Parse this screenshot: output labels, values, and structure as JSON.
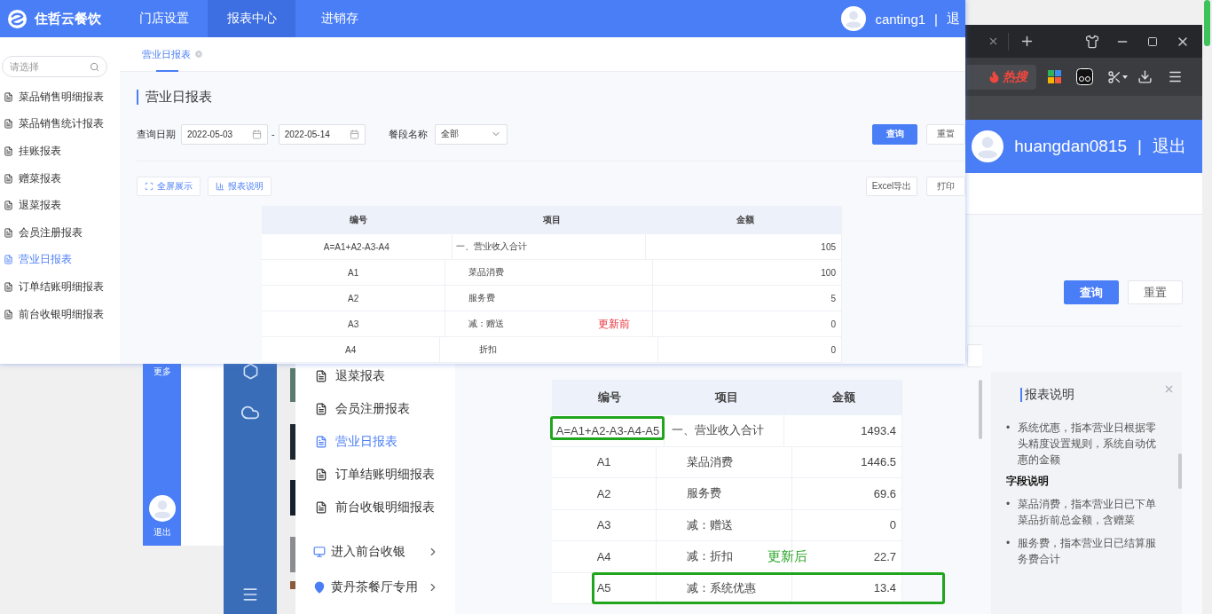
{
  "front_window": {
    "app_name": "住哲云餐饮",
    "nav": [
      {
        "label": "门店设置",
        "selected": false
      },
      {
        "label": "报表中心",
        "selected": true
      },
      {
        "label": "进销存",
        "selected": false
      }
    ],
    "user": {
      "name": "canting1",
      "separator": "|",
      "logout": "退"
    },
    "search": {
      "placeholder": "请选择"
    },
    "menu": [
      {
        "label": "菜品销售明细报表",
        "selected": false
      },
      {
        "label": "菜品销售统计报表",
        "selected": false
      },
      {
        "label": "挂账报表",
        "selected": false
      },
      {
        "label": "赠菜报表",
        "selected": false
      },
      {
        "label": "退菜报表",
        "selected": false
      },
      {
        "label": "会员注册报表",
        "selected": false
      },
      {
        "label": "营业日报表",
        "selected": true
      },
      {
        "label": "订单结账明细报表",
        "selected": false
      },
      {
        "label": "前台收银明细报表",
        "selected": false
      }
    ],
    "tabs": [
      {
        "label": "营业日报表",
        "selected": true
      }
    ],
    "page_title": "营业日报表",
    "filters": {
      "date_label": "查询日期",
      "date_from": "2022-05-03",
      "date_separator": "-",
      "date_to": "2022-05-14",
      "meal_label": "餐段名称",
      "meal_value": "全部"
    },
    "buttons": [
      {
        "label": "查询",
        "kind": "primary"
      },
      {
        "label": "重置",
        "kind": "default"
      }
    ],
    "tools": [
      {
        "label": "全屏展示",
        "kind": "fullscreen"
      },
      {
        "label": "报表说明",
        "kind": "chart"
      }
    ],
    "exports": [
      {
        "label": "Excel导出"
      },
      {
        "label": "打印"
      }
    ],
    "table": {
      "columns": [
        "编号",
        "项目",
        "金额"
      ],
      "rows": [
        {
          "code": "A=A1+A2-A3-A4",
          "item": "一、营业收入合计",
          "amount": "105",
          "kind": "total"
        },
        {
          "code": "A1",
          "item": "菜品消费",
          "amount": "100",
          "kind": "item"
        },
        {
          "code": "A2",
          "item": "服务费",
          "amount": "5",
          "kind": "item"
        },
        {
          "code": "A3",
          "item": "减：赠送",
          "amount": "0",
          "kind": "item",
          "note": "更新前"
        },
        {
          "code": "A4",
          "item": "折扣",
          "amount": "0",
          "kind": "detail"
        }
      ]
    }
  },
  "side_window": {
    "more": "更多",
    "logout": "退出"
  },
  "back_window": {
    "hot_search": "热搜",
    "user": {
      "name": "huangdan0815",
      "separator": "|",
      "logout": "退出"
    },
    "buttons": [
      {
        "label": "查询",
        "kind": "primary"
      },
      {
        "label": "重置",
        "kind": "default"
      }
    ],
    "menu": [
      {
        "label": "退菜报表",
        "selected": false
      },
      {
        "label": "会员注册报表",
        "selected": false
      },
      {
        "label": "营业日报表",
        "selected": true
      },
      {
        "label": "订单结账明细报表",
        "selected": false
      },
      {
        "label": "前台收银明细报表",
        "selected": false
      }
    ],
    "links": [
      {
        "label": "进入前台收银",
        "kind": "cashier"
      },
      {
        "label": "黄丹茶餐厅专用",
        "kind": "location"
      }
    ],
    "table": {
      "columns": [
        "编号",
        "项目",
        "金额"
      ],
      "rows": [
        {
          "code": "A=A1+A2-A3-A4-A5",
          "item": "一、营业收入合计",
          "amount": "1493.4",
          "kind": "total",
          "code_highlighted": true,
          "row_highlighted": false
        },
        {
          "code": "A1",
          "item": "菜品消费",
          "amount": "1446.5",
          "kind": "item",
          "code_highlighted": false,
          "row_highlighted": false
        },
        {
          "code": "A2",
          "item": "服务费",
          "amount": "69.6",
          "kind": "item",
          "code_highlighted": false,
          "row_highlighted": false
        },
        {
          "code": "A3",
          "item": "减：赠送",
          "amount": "0",
          "kind": "item",
          "code_highlighted": false,
          "row_highlighted": false
        },
        {
          "code": "A4",
          "item": "减：折扣",
          "amount": "22.7",
          "kind": "item",
          "code_highlighted": false,
          "row_highlighted": false,
          "note": "更新后"
        },
        {
          "code": "A5",
          "item": "减：系统优惠",
          "amount": "13.4",
          "kind": "item",
          "code_highlighted": false,
          "row_highlighted": true
        }
      ]
    },
    "help": {
      "title": "报表说明",
      "entries": [
        {
          "kind": "bullet",
          "marker": "•",
          "text": "系统优惠，指本营业日根据零头精度设置规则，系统自动优惠的金额"
        },
        {
          "kind": "heading",
          "text": "字段说明"
        },
        {
          "kind": "bullet",
          "marker": "•",
          "text": "菜品消费，指本营业日已下单菜品折前总金额，含赠菜"
        },
        {
          "kind": "bullet",
          "marker": "•",
          "text": "服务费，指本营业日已结算服务费合计"
        }
      ]
    }
  }
}
